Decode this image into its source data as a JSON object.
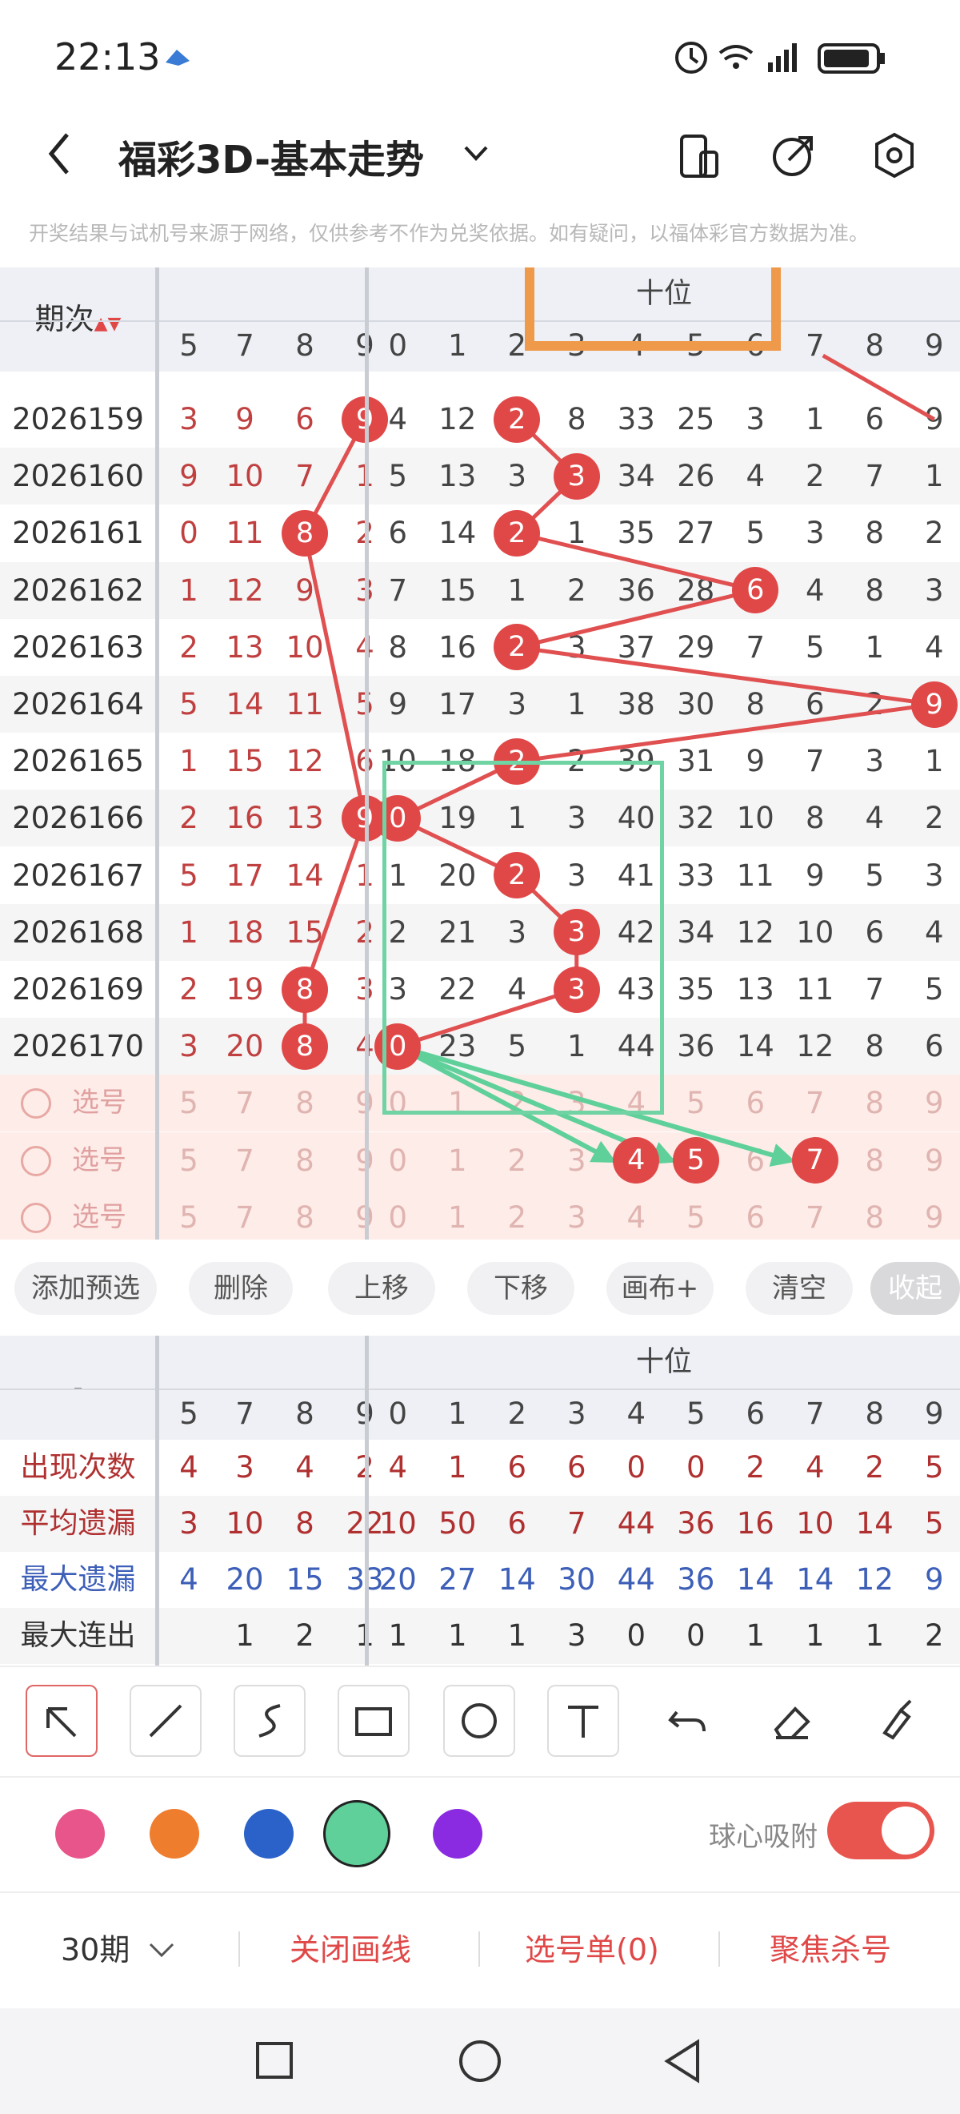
{
  "status": {
    "time": "22:13",
    "network": "6 5G"
  },
  "header": {
    "back": "‹",
    "title": "福彩3D-基本走势",
    "dropdown": "⌄"
  },
  "notice": "开奖结果与试机号来源于网络，仅供参考不作为兑奖依据。如有疑问，以福体彩官方数据为准。",
  "table": {
    "period_header": "期次",
    "group_title": "十位",
    "prev_cols": [
      "5",
      "7",
      "8",
      "9"
    ],
    "ten_cols": [
      "0",
      "1",
      "2",
      "3",
      "4",
      "5",
      "6",
      "7",
      "8",
      "9"
    ],
    "rows": [
      {
        "period": "2026159",
        "prev": [
          "3",
          "9",
          "6",
          "9"
        ],
        "ten": [
          "4",
          "12",
          "2",
          "8",
          "33",
          "25",
          "3",
          "1",
          "6",
          "9"
        ]
      },
      {
        "period": "2026160",
        "prev": [
          "9",
          "10",
          "7",
          "1"
        ],
        "ten": [
          "5",
          "13",
          "3",
          "3",
          "34",
          "26",
          "4",
          "2",
          "7",
          "1"
        ]
      },
      {
        "period": "2026161",
        "prev": [
          "0",
          "11",
          "8",
          "2"
        ],
        "ten": [
          "6",
          "14",
          "2",
          "1",
          "35",
          "27",
          "5",
          "3",
          "8",
          "2"
        ]
      },
      {
        "period": "2026162",
        "prev": [
          "1",
          "12",
          "9",
          "3"
        ],
        "ten": [
          "7",
          "15",
          "1",
          "2",
          "36",
          "28",
          "6",
          "4",
          "8",
          "3"
        ]
      },
      {
        "period": "2026163",
        "prev": [
          "2",
          "13",
          "10",
          "4"
        ],
        "ten": [
          "8",
          "16",
          "2",
          "3",
          "37",
          "29",
          "7",
          "5",
          "1",
          "4"
        ]
      },
      {
        "period": "2026164",
        "prev": [
          "5",
          "14",
          "11",
          "5"
        ],
        "ten": [
          "9",
          "17",
          "3",
          "1",
          "38",
          "30",
          "8",
          "6",
          "2",
          "9"
        ]
      },
      {
        "period": "2026165",
        "prev": [
          "1",
          "15",
          "12",
          "6"
        ],
        "ten": [
          "10",
          "18",
          "2",
          "2",
          "39",
          "31",
          "9",
          "7",
          "3",
          "1"
        ]
      },
      {
        "period": "2026166",
        "prev": [
          "2",
          "16",
          "13",
          "9"
        ],
        "ten": [
          "0",
          "19",
          "1",
          "3",
          "40",
          "32",
          "10",
          "8",
          "4",
          "2"
        ]
      },
      {
        "period": "2026167",
        "prev": [
          "5",
          "17",
          "14",
          "1"
        ],
        "ten": [
          "1",
          "20",
          "2",
          "3",
          "41",
          "33",
          "11",
          "9",
          "5",
          "3"
        ]
      },
      {
        "period": "2026168",
        "prev": [
          "1",
          "18",
          "15",
          "2"
        ],
        "ten": [
          "2",
          "21",
          "3",
          "3",
          "42",
          "34",
          "12",
          "10",
          "6",
          "4"
        ]
      },
      {
        "period": "2026169",
        "prev": [
          "2",
          "19",
          "8",
          "3"
        ],
        "ten": [
          "3",
          "22",
          "4",
          "3",
          "43",
          "35",
          "13",
          "11",
          "7",
          "5"
        ]
      },
      {
        "period": "2026170",
        "prev": [
          "3",
          "20",
          "8",
          "4"
        ],
        "ten": [
          "0",
          "23",
          "5",
          "1",
          "44",
          "36",
          "14",
          "12",
          "8",
          "6"
        ]
      }
    ],
    "select_label": "选号"
  },
  "buttons": [
    "添加预选",
    "删除",
    "上移",
    "下移",
    "画布+",
    "清空",
    "收起"
  ],
  "stats": {
    "corner": "-",
    "group_title": "十位",
    "prev_cols": [
      "5",
      "7",
      "8",
      "9"
    ],
    "ten_cols": [
      "0",
      "1",
      "2",
      "3",
      "4",
      "5",
      "6",
      "7",
      "8",
      "9"
    ],
    "rows": [
      {
        "label": "出现次数",
        "prev": [
          "4",
          "3",
          "4",
          "2"
        ],
        "ten": [
          "4",
          "1",
          "6",
          "6",
          "0",
          "0",
          "2",
          "4",
          "2",
          "5"
        ],
        "color": "#b03030"
      },
      {
        "label": "平均遗漏",
        "prev": [
          "3",
          "10",
          "8",
          "22"
        ],
        "ten": [
          "10",
          "50",
          "6",
          "7",
          "44",
          "36",
          "16",
          "10",
          "14",
          "5"
        ],
        "color": "#b03030"
      },
      {
        "label": "最大遗漏",
        "prev": [
          "4",
          "20",
          "15",
          "33"
        ],
        "ten": [
          "20",
          "27",
          "14",
          "30",
          "44",
          "36",
          "14",
          "14",
          "12",
          "9"
        ],
        "color": "#3d5fb8"
      },
      {
        "label": "最大连出",
        "prev": [
          "",
          "1",
          "2",
          "1"
        ],
        "ten": [
          "1",
          "1",
          "1",
          "3",
          "0",
          "0",
          "1",
          "1",
          "1",
          "2"
        ],
        "color": "#333333"
      }
    ]
  },
  "tools": [
    "arrow-icon",
    "line-icon",
    "curve-icon",
    "rectangle-icon",
    "circle-icon",
    "text-icon",
    "undo-icon",
    "eraser-icon",
    "brush-icon"
  ],
  "colors": [
    "#e8558a",
    "#ef7d2e",
    "#2a62c9",
    "#5fd09a",
    "#8a2be2"
  ],
  "magnet_label": "球心吸附",
  "bottom": {
    "periods": "30期",
    "close_draw": "关闭画线",
    "select_list": "选号单(0)",
    "focus_kill": "聚焦杀号"
  },
  "accent": "#e04848"
}
